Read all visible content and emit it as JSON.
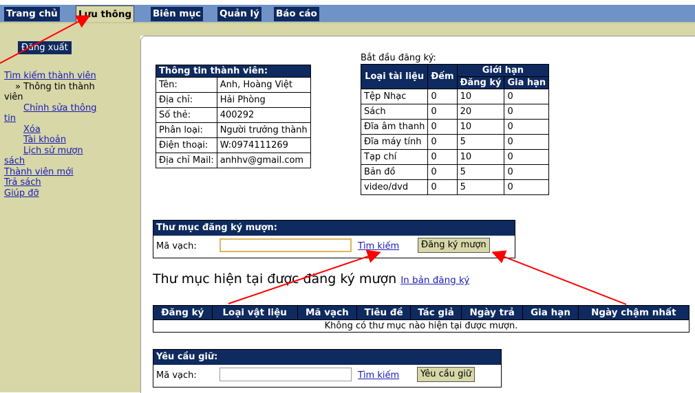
{
  "tabs": [
    "Trang chủ",
    "Lưu thông",
    "Biên mục",
    "Quản lý",
    "Báo cáo"
  ],
  "sidebar": {
    "logout": "Đăng xuất",
    "items": [
      {
        "label": "Tìm kiếm thành viên"
      },
      {
        "label": "» Thông tin thành"
      },
      {
        "label": "viên"
      },
      {
        "label": "Chỉnh sửa thông"
      },
      {
        "label": "tin"
      },
      {
        "label": "Xóa"
      },
      {
        "label": "Tài khoản"
      },
      {
        "label": "Lịch sử mượn"
      },
      {
        "label": "sách"
      },
      {
        "label": "Thành viên mới"
      },
      {
        "label": "Trả sách"
      },
      {
        "label": "Giúp đỡ"
      }
    ]
  },
  "member": {
    "title": "Thông tin thành viên:",
    "rows": [
      [
        "Tên:",
        "Anh, Hoàng Việt"
      ],
      [
        "Địa chỉ:",
        "Hải Phòng"
      ],
      [
        "Số thẻ:",
        "400292"
      ],
      [
        "Phân loại:",
        "Người trưởng thành"
      ],
      [
        "Điện thoại:",
        "W:0974111269"
      ],
      [
        "Địa chỉ Mail:",
        "anhhv@gmail.com"
      ]
    ]
  },
  "limits": {
    "begin_label": "Bắt đầu đăng ký:",
    "col_type": "Loại tài liệu",
    "col_count": "Đếm",
    "col_limit": "Giới hạn",
    "col_register": "Đăng ký",
    "col_renew": "Gia hạn",
    "rows": [
      [
        "Tệp Nhạc",
        "0",
        "10",
        "0"
      ],
      [
        "Sách",
        "0",
        "20",
        "0"
      ],
      [
        "Đĩa âm thanh",
        "0",
        "10",
        "0"
      ],
      [
        "Đĩa máy tính",
        "0",
        "5",
        "0"
      ],
      [
        "Tạp chí",
        "0",
        "10",
        "0"
      ],
      [
        "Bản đồ",
        "0",
        "5",
        "0"
      ],
      [
        "video/dvd",
        "0",
        "5",
        "0"
      ]
    ]
  },
  "checkout": {
    "title": "Thư mục đăng ký mượn:",
    "barcode_label": "Mã vạch:",
    "search": "Tìm kiếm",
    "button": "Đăng ký mượn"
  },
  "current": {
    "title": "Thư mục hiện tại được đăng ký mượn",
    "print_link": "In bản đăng ký",
    "headers": [
      "Đăng ký",
      "Loại vật liệu",
      "Mã vạch",
      "Tiêu đề",
      "Tác giả",
      "Ngày trả",
      "Gia hạn",
      "Ngày chậm nhất"
    ],
    "empty": "Không có thư mục nào hiện tại được mượn."
  },
  "hold": {
    "title": "Yêu cầu giữ:",
    "barcode_label": "Mã vạch:",
    "search": "Tìm kiếm",
    "button": "Yêu cầu giữ"
  },
  "colors": {
    "navy": "#0e2a5f",
    "tan": "#d7d7a8",
    "tab_blue": "#6f93c7",
    "link": "#1a1ab8",
    "arrow": "#ff0000"
  }
}
